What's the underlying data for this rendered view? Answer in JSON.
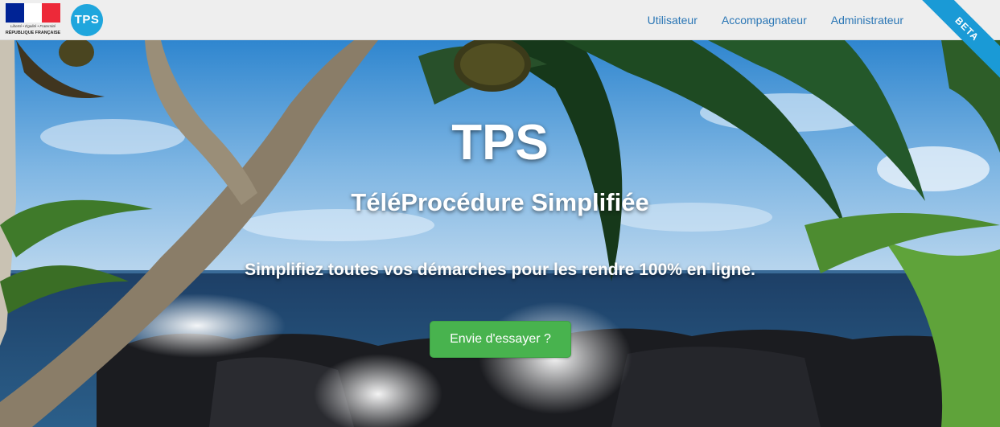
{
  "header": {
    "gov_logo": {
      "motto": "Liberté • Égalité • Fraternité",
      "republic": "RÉPUBLIQUE FRANÇAISE",
      "flag_colors": [
        "#002395",
        "#ffffff",
        "#ed2939"
      ]
    },
    "app_logo": {
      "text": "TPS",
      "color": "#1fa6dd"
    },
    "nav": [
      {
        "label": "Utilisateur"
      },
      {
        "label": "Accompagnateur"
      },
      {
        "label": "Administrateur"
      }
    ],
    "ribbon": {
      "label": "BETA",
      "color": "#1a9ad6"
    }
  },
  "hero": {
    "title": "TPS",
    "subtitle": "TéléProcédure Simplifiée",
    "tagline": "Simplifiez toutes vos démarches pour les rendre 100% en ligne.",
    "cta_label": "Envie d'essayer ?",
    "cta_color": "#48b34e"
  }
}
